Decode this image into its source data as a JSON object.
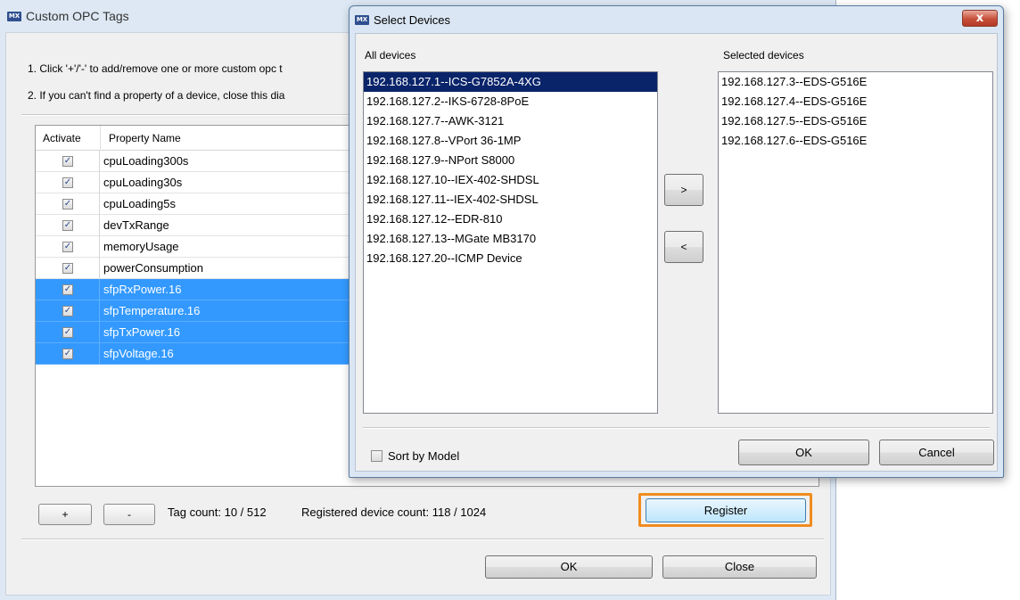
{
  "opc_dialog": {
    "title": "Custom OPC Tags",
    "instructions": [
      "1. Click '+'/'-' to add/remove one or more custom opc t",
      "2. If you can't find a property of a device, close this dia"
    ],
    "columns": {
      "activate": "Activate",
      "property_name": "Property Name"
    },
    "rows": [
      {
        "checked": "✓",
        "property": "cpuLoading300s",
        "selected": false
      },
      {
        "checked": "✓",
        "property": "cpuLoading30s",
        "selected": false
      },
      {
        "checked": "✓",
        "property": "cpuLoading5s",
        "selected": false
      },
      {
        "checked": "✓",
        "property": "devTxRange",
        "selected": false
      },
      {
        "checked": "✓",
        "property": "memoryUsage",
        "selected": false
      },
      {
        "checked": "✓",
        "property": "powerConsumption",
        "selected": false
      },
      {
        "checked": "✓",
        "property": "sfpRxPower.16",
        "selected": true
      },
      {
        "checked": "✓",
        "property": "sfpTemperature.16",
        "selected": true
      },
      {
        "checked": "✓",
        "property": "sfpTxPower.16",
        "selected": true
      },
      {
        "checked": "✓",
        "property": "sfpVoltage.16",
        "selected": true
      }
    ],
    "add_label": "+",
    "remove_label": "-",
    "tag_count": "Tag count:  10 / 512",
    "device_count": "Registered device count:  118 / 1024",
    "register_label": "Register",
    "ok_label": "OK",
    "close_label": "Close"
  },
  "select_devices": {
    "title": "Select Devices",
    "close_glyph": "x",
    "all_label": "All devices",
    "selected_label": "Selected devices",
    "all_devices": [
      "192.168.127.1--ICS-G7852A-4XG",
      "192.168.127.2--IKS-6728-8PoE",
      "192.168.127.7--AWK-3121",
      "192.168.127.8--VPort 36-1MP",
      "192.168.127.9--NPort S8000",
      "192.168.127.10--IEX-402-SHDSL",
      "192.168.127.11--IEX-402-SHDSL",
      "192.168.127.12--EDR-810",
      "192.168.127.13--MGate MB3170",
      "192.168.127.20--ICMP Device"
    ],
    "all_selected_index": 0,
    "selected_devices": [
      "192.168.127.3--EDS-G516E",
      "192.168.127.4--EDS-G516E",
      "192.168.127.5--EDS-G516E",
      "192.168.127.6--EDS-G516E"
    ],
    "move_right_label": ">",
    "move_left_label": "<",
    "sort_by_model_label": "Sort by Model",
    "ok_label": "OK",
    "cancel_label": "Cancel"
  },
  "logo_text": "MX",
  "colors": {
    "highlight": "#f08c1e",
    "row_selected": "#3399ff",
    "list_selected": "#0a246a"
  }
}
